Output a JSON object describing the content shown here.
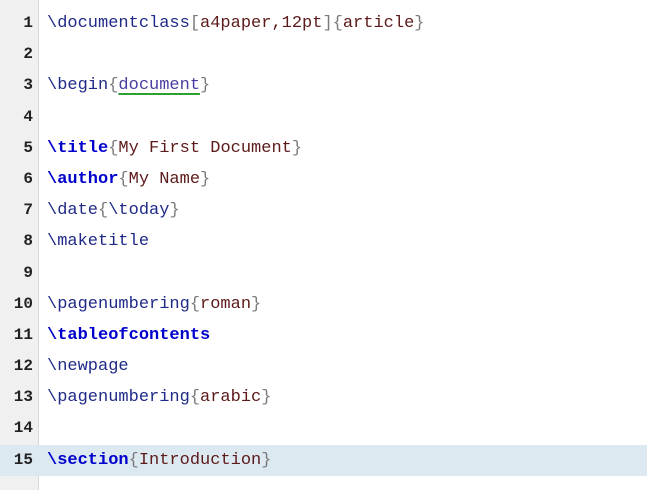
{
  "editor": {
    "current_line": 15,
    "lines": [
      {
        "num": "1",
        "parts": [
          {
            "t": "\\documentclass",
            "c": "cmd"
          },
          {
            "t": "[",
            "c": "br"
          },
          {
            "t": "a4paper,12pt",
            "c": "arg"
          },
          {
            "t": "]",
            "c": "br"
          },
          {
            "t": "{",
            "c": "br"
          },
          {
            "t": "article",
            "c": "arg"
          },
          {
            "t": "}",
            "c": "br"
          }
        ]
      },
      {
        "num": "2",
        "parts": []
      },
      {
        "num": "3",
        "parts": [
          {
            "t": "\\begin",
            "c": "cmd"
          },
          {
            "t": "{",
            "c": "br"
          },
          {
            "t": "document",
            "c": "env"
          },
          {
            "t": "}",
            "c": "br"
          }
        ]
      },
      {
        "num": "4",
        "parts": []
      },
      {
        "num": "5",
        "parts": [
          {
            "t": "\\title",
            "c": "kw"
          },
          {
            "t": "{",
            "c": "br"
          },
          {
            "t": "My First Document",
            "c": "arg"
          },
          {
            "t": "}",
            "c": "br"
          }
        ]
      },
      {
        "num": "6",
        "parts": [
          {
            "t": "\\author",
            "c": "kw"
          },
          {
            "t": "{",
            "c": "br"
          },
          {
            "t": "My Name",
            "c": "arg"
          },
          {
            "t": "}",
            "c": "br"
          }
        ]
      },
      {
        "num": "7",
        "parts": [
          {
            "t": "\\date",
            "c": "cmd"
          },
          {
            "t": "{",
            "c": "br"
          },
          {
            "t": "\\today",
            "c": "cmd"
          },
          {
            "t": "}",
            "c": "br"
          }
        ]
      },
      {
        "num": "8",
        "parts": [
          {
            "t": "\\maketitle",
            "c": "cmd"
          }
        ]
      },
      {
        "num": "9",
        "parts": []
      },
      {
        "num": "10",
        "parts": [
          {
            "t": "\\pagenumbering",
            "c": "cmd"
          },
          {
            "t": "{",
            "c": "br"
          },
          {
            "t": "roman",
            "c": "arg"
          },
          {
            "t": "}",
            "c": "br"
          }
        ]
      },
      {
        "num": "11",
        "parts": [
          {
            "t": "\\tableofcontents",
            "c": "kw"
          }
        ]
      },
      {
        "num": "12",
        "parts": [
          {
            "t": "\\newpage",
            "c": "cmd"
          }
        ]
      },
      {
        "num": "13",
        "parts": [
          {
            "t": "\\pagenumbering",
            "c": "cmd"
          },
          {
            "t": "{",
            "c": "br"
          },
          {
            "t": "arabic",
            "c": "arg"
          },
          {
            "t": "}",
            "c": "br"
          }
        ]
      },
      {
        "num": "14",
        "parts": []
      },
      {
        "num": "15",
        "parts": [
          {
            "t": "\\section",
            "c": "kw"
          },
          {
            "t": "{",
            "c": "br"
          },
          {
            "t": "Introduction",
            "c": "arg"
          },
          {
            "t": "}",
            "c": "br"
          }
        ]
      }
    ]
  }
}
